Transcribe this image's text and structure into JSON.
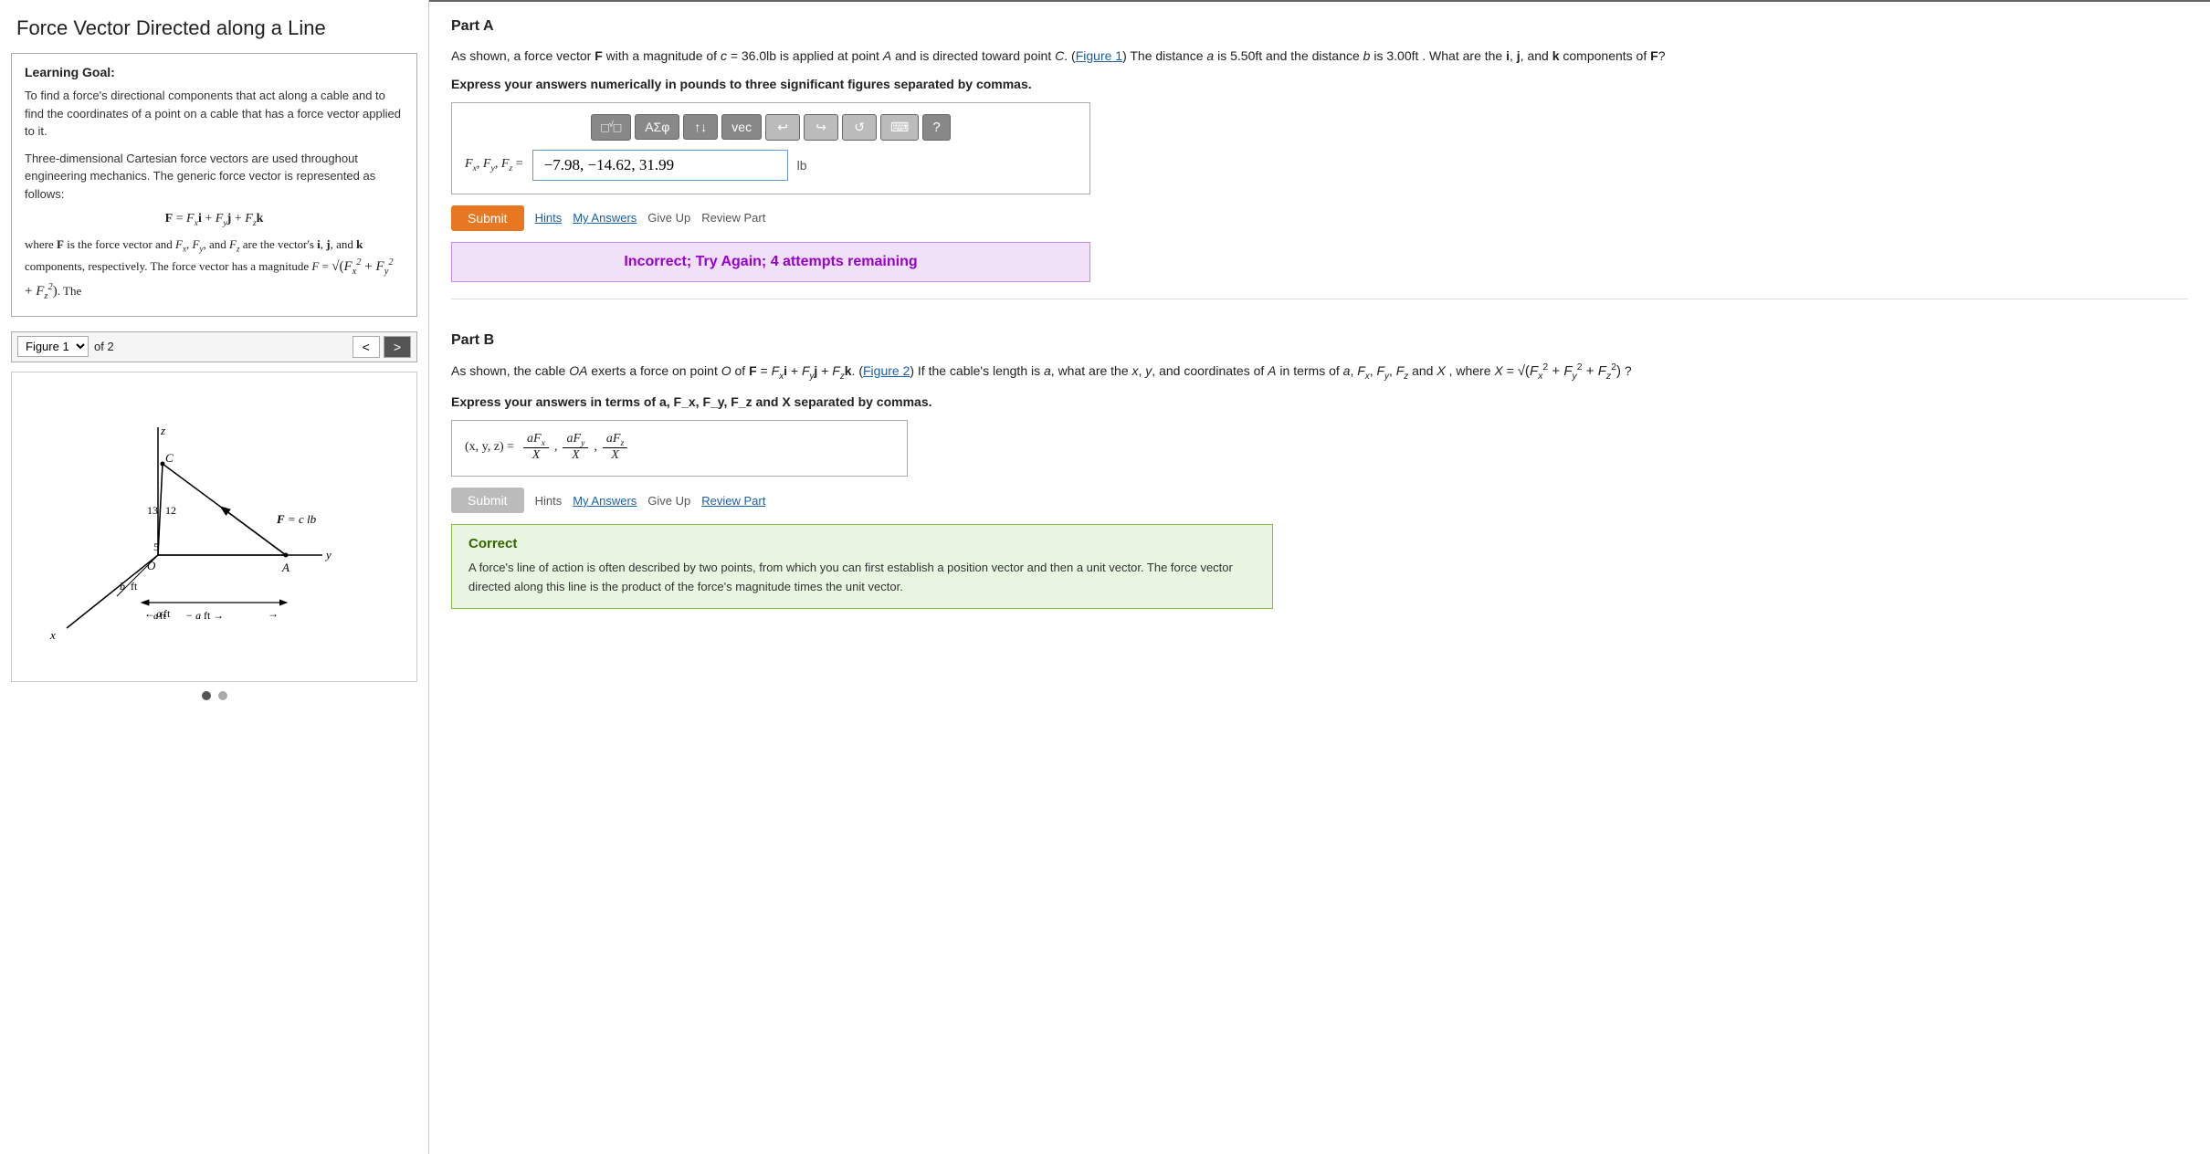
{
  "page": {
    "title": "Force Vector Directed along a Line"
  },
  "left_panel": {
    "learning_goal": {
      "title": "Learning Goal:",
      "paragraphs": [
        "To find a force's directional components that act along a cable and to find the coordinates of a point on a cable that has a force vector applied to it.",
        "Three-dimensional Cartesian force vectors are used throughout engineering mechanics. The generic force vector is represented as follows:"
      ],
      "formula_main": "F = F_x i + F_y j + F_z k",
      "formula_desc": "where F is the force vector and F_x, F_y, and F_z are the vector's i, j, and k components, respectively. The force vector has a magnitude F = sqrt(F_x^2 + F_y^2 + F_z^2). The"
    },
    "figure_nav": {
      "select_value": "Figure 1",
      "of_text": "of 2",
      "prev_btn": "<",
      "next_btn": ">"
    },
    "dots": [
      "active",
      "inactive"
    ]
  },
  "part_a": {
    "title": "Part A",
    "description": "As shown, a force vector F with a magnitude of c = 36.0lb is applied at point A and is directed toward point C. (Figure 1) The distance a is 5.50ft and the distance b is 3.00ft . What are the i, j, and k components of F?",
    "instruction": "Express your answers numerically in pounds to three significant figures separated by commas.",
    "toolbar": {
      "btn1": "□√□",
      "btn2": "ΑΣφ",
      "btn3": "↕↓",
      "btn4": "vec",
      "btn5": "↩",
      "btn6": "↪",
      "btn7": "↺",
      "btn8": "⌨",
      "btn9": "?"
    },
    "input_label": "F_x, F_y, F_z =",
    "input_value": "−7.98, −14.62, 31.99",
    "unit": "lb",
    "actions": {
      "submit": "Submit",
      "hints": "Hints",
      "my_answers": "My Answers",
      "give_up": "Give Up",
      "review_part": "Review Part"
    },
    "feedback": {
      "type": "incorrect",
      "text": "Incorrect; Try Again; 4 attempts remaining"
    }
  },
  "part_b": {
    "title": "Part B",
    "description": "As shown, the cable OA exerts a force on point O of F = F_x i + F_y j + F_z k. (Figure 2) If the cable's length is a, what are the x, y, and coordinates of A in terms of a, F_x, F_y, F_z and X , where X = sqrt(F_x^2 + F_y^2 + F_z^2) ?",
    "instruction": "Express your answers in terms of a, F_x, F_y, F_z and X separated by commas.",
    "input_label": "(x, y, z) =",
    "input_value": "aF_x/X , aF_y/X , aF_z/X",
    "actions": {
      "submit": "Submit",
      "hints": "Hints",
      "my_answers": "My Answers",
      "give_up": "Give Up",
      "review_part": "Review Part"
    },
    "feedback": {
      "type": "correct",
      "title": "Correct",
      "text": "A force's line of action is often described by two points, from which you can first establish a position vector and then a unit vector. The force vector directed along this line is the product of the force's magnitude times the unit vector."
    }
  },
  "colors": {
    "submit_orange": "#e87722",
    "submit_disabled": "#bbb",
    "incorrect_bg": "#f0e0f8",
    "incorrect_border": "#cc88ee",
    "incorrect_text": "#9900cc",
    "correct_bg": "#e8f5e0",
    "correct_border": "#88bb44",
    "correct_title": "#336600",
    "link_blue": "#1a5fa8",
    "input_border": "#6699cc"
  }
}
